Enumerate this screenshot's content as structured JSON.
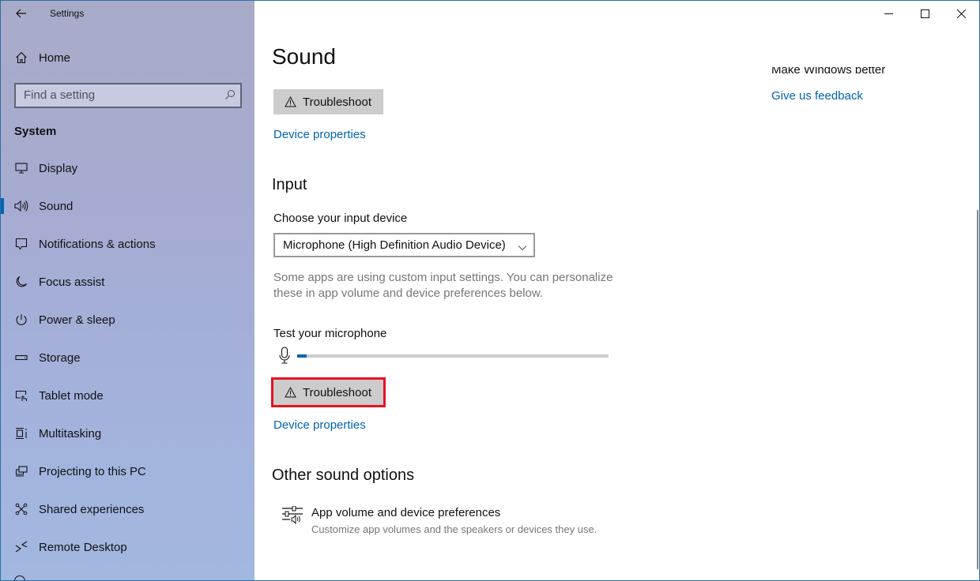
{
  "window": {
    "title": "Settings",
    "controls": {
      "minimize": "minimize-icon",
      "maximize": "maximize-icon",
      "close": "close-icon"
    }
  },
  "sidebar": {
    "home_label": "Home",
    "search_placeholder": "Find a setting",
    "section_label": "System",
    "items": [
      {
        "label": "Display",
        "icon": "display-icon"
      },
      {
        "label": "Sound",
        "icon": "speaker-icon",
        "active": true
      },
      {
        "label": "Notifications & actions",
        "icon": "notification-icon"
      },
      {
        "label": "Focus assist",
        "icon": "moon-icon"
      },
      {
        "label": "Power & sleep",
        "icon": "power-icon"
      },
      {
        "label": "Storage",
        "icon": "storage-icon"
      },
      {
        "label": "Tablet mode",
        "icon": "tablet-mode-icon"
      },
      {
        "label": "Multitasking",
        "icon": "multitasking-icon"
      },
      {
        "label": "Projecting to this PC",
        "icon": "projecting-icon"
      },
      {
        "label": "Shared experiences",
        "icon": "shared-experiences-icon"
      },
      {
        "label": "Remote Desktop",
        "icon": "remote-desktop-icon"
      }
    ]
  },
  "main": {
    "page_title": "Sound",
    "output": {
      "troubleshoot_label": "Troubleshoot",
      "device_properties_label": "Device properties"
    },
    "input": {
      "heading": "Input",
      "choose_label": "Choose your input device",
      "selected_device": "Microphone (High Definition Audio Device)",
      "note": "Some apps are using custom input settings. You can personalize these in app volume and device preferences below.",
      "test_label": "Test your microphone",
      "mic_level_percent": 3,
      "troubleshoot_label": "Troubleshoot",
      "device_properties_label": "Device properties"
    },
    "other": {
      "heading": "Other sound options",
      "option_title": "App volume and device preferences",
      "option_subtitle": "Customize app volumes and the speakers or devices they use."
    }
  },
  "side_panel": {
    "partial_heading": "Make Windows better",
    "feedback_link": "Give us feedback"
  },
  "colors": {
    "accent": "#0063b1",
    "highlight_border": "#e81123",
    "button_bg": "#cccccc"
  }
}
